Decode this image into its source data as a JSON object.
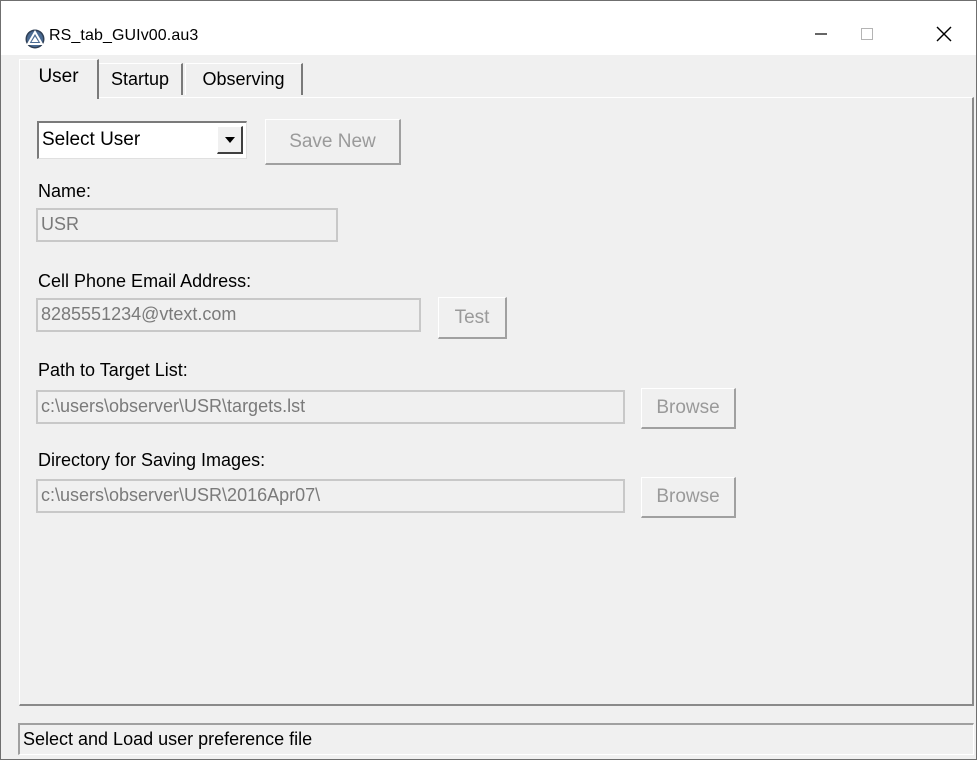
{
  "window": {
    "title": "RS_tab_GUIv00.au3",
    "icon": "autoit-app-icon"
  },
  "tabs": [
    {
      "label": "User",
      "active": true
    },
    {
      "label": "Startup",
      "active": false
    },
    {
      "label": "Observing",
      "active": false
    }
  ],
  "user_tab": {
    "user_select": {
      "selected": "Select User"
    },
    "save_new_label": "Save New",
    "name": {
      "label": "Name:",
      "value": "USR"
    },
    "cell_email": {
      "label": "Cell Phone Email Address:",
      "value": "8285551234@vtext.com",
      "button": "Test"
    },
    "target_list": {
      "label": "Path to Target List:",
      "value": "c:\\users\\observer\\USR\\targets.lst",
      "button": "Browse"
    },
    "image_dir": {
      "label": "Directory for Saving Images:",
      "value": "c:\\users\\observer\\USR\\2016Apr07\\",
      "button": "Browse"
    }
  },
  "status_bar": {
    "text": "Select and Load user preference file"
  }
}
